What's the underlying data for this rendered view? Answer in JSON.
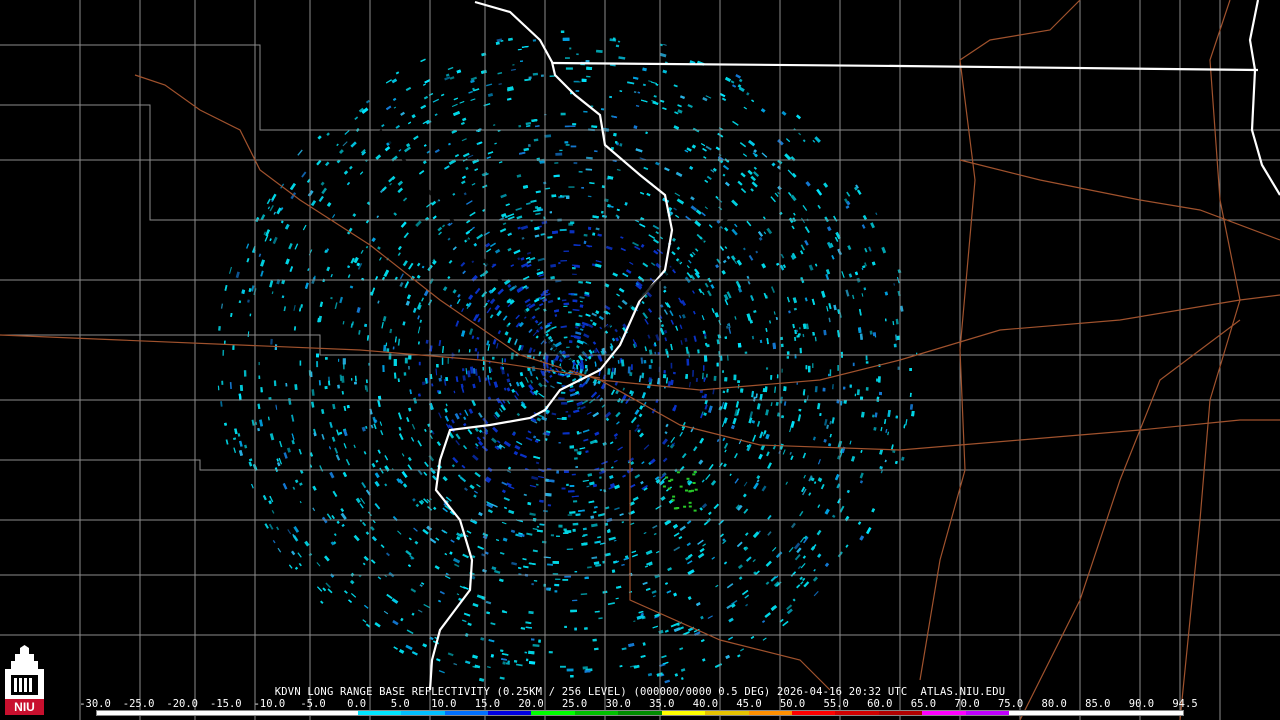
{
  "map": {
    "radar_site": "KDVN",
    "product": "LONG RANGE BASE REFLECTIVITY",
    "resolution": "(0.25KM / 256 LEVEL)",
    "volume_id": "(000000/0000 0.5 DEG)",
    "timestamp": "2026-04-16 20:32 UTC",
    "source": "ATLAS.NIU.EDU",
    "colors": {
      "background": "#000000",
      "state_border": "#ffffff",
      "county_line": "#8c8c8c",
      "road": "#a0522d",
      "echo_light": "#00d7e6",
      "echo_dark": "#0a32c8",
      "radar_site_marker": "#000000"
    }
  },
  "legend": {
    "ticks": [
      "-30.0",
      "-25.0",
      "-20.0",
      "-15.0",
      "-10.0",
      "-5.0",
      "0.0",
      "5.0",
      "10.0",
      "15.0",
      "20.0",
      "25.0",
      "30.0",
      "35.0",
      "40.0",
      "45.0",
      "50.0",
      "55.0",
      "60.0",
      "65.0",
      "70.0",
      "75.0",
      "80.0",
      "85.0",
      "90.0",
      "94.5"
    ],
    "colors": [
      "#ffffff",
      "#ffffff",
      "#ffffff",
      "#ffffff",
      "#ffffff",
      "#ffffff",
      "#00e5ff",
      "#00bfff",
      "#0070ff",
      "#0000e0",
      "#00ff00",
      "#00c000",
      "#008c00",
      "#ffff00",
      "#e6c200",
      "#ff9000",
      "#ff0000",
      "#d00000",
      "#b00000",
      "#ff00ff",
      "#c000ff",
      "#ffffff",
      "#ffffff",
      "#ffffff",
      "#ffffff"
    ]
  },
  "logo": {
    "text": "NIU",
    "icon": "niu-tower-logo-icon",
    "color": "#c8102e"
  }
}
